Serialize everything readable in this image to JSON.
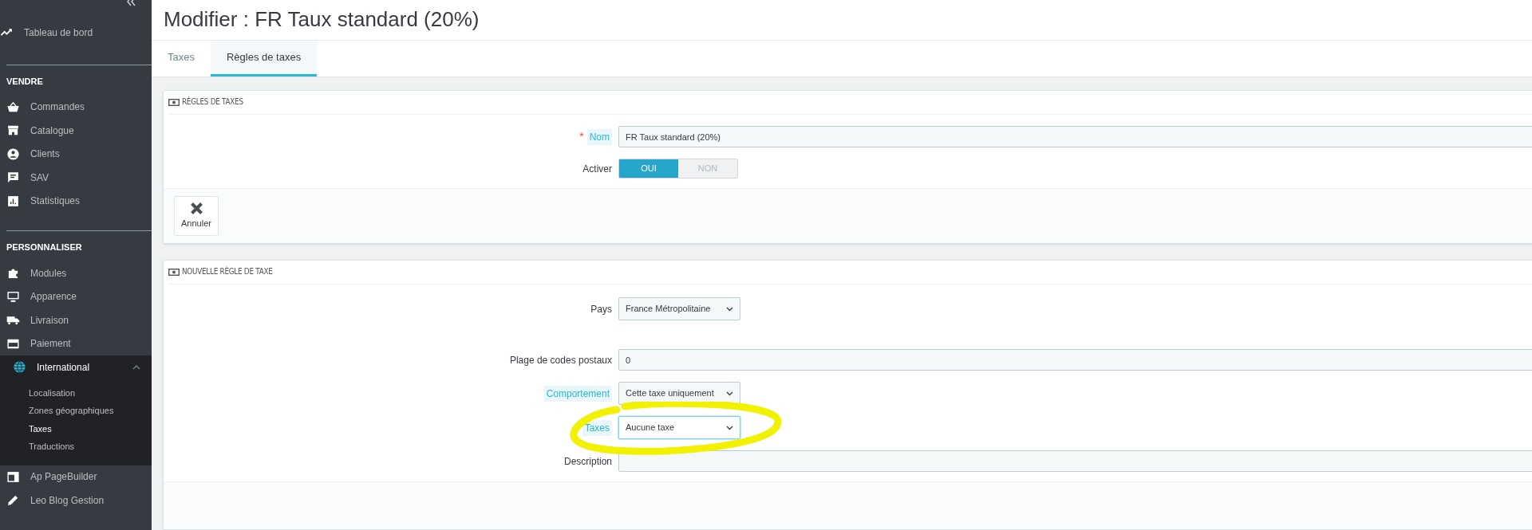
{
  "sidebar": {
    "sections": [
      {
        "items": [
          {
            "label": "Tableau de bord"
          }
        ]
      },
      {
        "heading": "VENDRE",
        "items": [
          {
            "label": "Commandes"
          },
          {
            "label": "Catalogue"
          },
          {
            "label": "Clients"
          },
          {
            "label": "SAV"
          },
          {
            "label": "Statistiques"
          }
        ]
      },
      {
        "heading": "PERSONNALISER",
        "items": [
          {
            "label": "Modules"
          },
          {
            "label": "Apparence"
          },
          {
            "label": "Livraison"
          },
          {
            "label": "Paiement"
          },
          {
            "label": "International",
            "expanded": true,
            "children": [
              {
                "label": "Localisation",
                "selected": false
              },
              {
                "label": "Zones géographiques",
                "selected": false
              },
              {
                "label": "Taxes",
                "selected": true
              },
              {
                "label": "Traductions",
                "selected": false
              }
            ]
          },
          {
            "label": "Ap PageBuilder"
          },
          {
            "label": "Leo Blog Gestion"
          }
        ]
      }
    ]
  },
  "page_title": "Modifier : FR Taux standard (20%)",
  "tabs": [
    {
      "label": "Taxes",
      "selected": false
    },
    {
      "label": "Règles de taxes",
      "selected": true
    }
  ],
  "panels": [
    {
      "title": "RÈGLES DE TAXES",
      "fields": [
        {
          "kind": "text",
          "label": "Nom",
          "required_mark": "*",
          "help": true,
          "value": "FR Taux standard (20%)"
        },
        {
          "kind": "switch",
          "label": "Activer",
          "options": [
            {
              "label": "OUI",
              "selected": true
            },
            {
              "label": "NON",
              "selected": false
            }
          ]
        }
      ],
      "footer_buttons": [
        "Annuler"
      ]
    },
    {
      "title": "NOUVELLE RÈGLE DE TAXE",
      "fields": [
        {
          "kind": "select",
          "label": "Pays",
          "value": "France Métropolitaine"
        },
        {
          "kind": "text",
          "label": "Plage de codes postaux",
          "value": "0"
        },
        {
          "kind": "select",
          "label": "Comportement",
          "help": true,
          "value": "Cette taxe uniquement"
        },
        {
          "kind": "select",
          "label": "Taxes",
          "help": true,
          "focused": true,
          "circled": true,
          "value": "Aucune taxe"
        },
        {
          "kind": "text",
          "label": "Description"
        }
      ]
    }
  ]
}
